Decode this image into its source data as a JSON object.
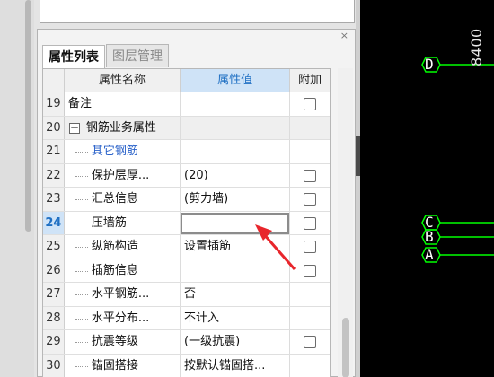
{
  "tabs": [
    {
      "label": "属性列表",
      "active": true
    },
    {
      "label": "图层管理",
      "active": false
    }
  ],
  "dock": {
    "close_label": "×"
  },
  "columns": {
    "num": "",
    "name": "属性名称",
    "value": "属性值",
    "extra": "附加"
  },
  "rows": [
    {
      "num": "19",
      "name": "备注",
      "value": "",
      "checkbox": true
    },
    {
      "num": "20",
      "name": "钢筋业务属性",
      "value": "",
      "checkbox": false,
      "expander": "−"
    },
    {
      "num": "21",
      "name": "其它钢筋",
      "value": "",
      "checkbox": false
    },
    {
      "num": "22",
      "name": "保护层厚...",
      "value": "(20)",
      "checkbox": true
    },
    {
      "num": "23",
      "name": "汇总信息",
      "value": "(剪力墙)",
      "checkbox": true
    },
    {
      "num": "24",
      "name": "压墙筋",
      "value": "",
      "checkbox": true,
      "selected": true
    },
    {
      "num": "25",
      "name": "纵筋构造",
      "value": "设置插筋",
      "checkbox": true
    },
    {
      "num": "26",
      "name": "插筋信息",
      "value": "",
      "checkbox": true
    },
    {
      "num": "27",
      "name": "水平钢筋...",
      "value": "否",
      "checkbox": false
    },
    {
      "num": "28",
      "name": "水平分布...",
      "value": "不计入",
      "checkbox": false
    },
    {
      "num": "29",
      "name": "抗震等级",
      "value": "(一级抗震)",
      "checkbox": true
    },
    {
      "num": "30",
      "name": "锚固搭接",
      "value": "按默认锚固搭...",
      "checkbox": false
    }
  ],
  "canvas": {
    "axes_top": [
      {
        "label": "D"
      }
    ],
    "axes_bottom": [
      {
        "label": "C"
      },
      {
        "label": "B"
      },
      {
        "label": "A"
      }
    ],
    "dimension": "8400",
    "axis_color": "#00ff00",
    "line_color": "#00ff00"
  },
  "annotation": {
    "color": "#e8262c"
  }
}
